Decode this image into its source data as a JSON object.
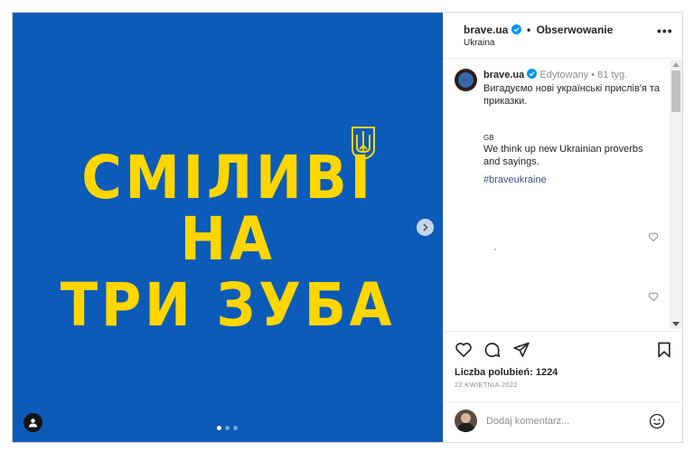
{
  "media": {
    "poster_lines": [
      "СМІЛИВІ",
      "НА",
      "ТРИ ЗУБА"
    ],
    "background_color": "#0d5bb8",
    "text_color": "#ffd600",
    "icons": [
      "trident-icon",
      "chevron-right-icon",
      "person-tag-icon"
    ],
    "carousel": {
      "total": 3,
      "active": 1
    }
  },
  "header": {
    "username": "brave.ua",
    "separator": "•",
    "follow_label": "Obserwowanie",
    "location": "Ukraina",
    "more_label": "•••"
  },
  "caption": {
    "username": "brave.ua",
    "meta": "Edytowany •  81 tyg.",
    "text_ua": "Вигадуємо нові українські прислів'я та приказки.",
    "gb_label": "GB",
    "text_en": "We think up new Ukrainian proverbs and sayings.",
    "hashtag": "#braveukraine"
  },
  "engagement": {
    "likes": "Liczba polubień: 1224",
    "date": "22 KWIETNIA 2022"
  },
  "add_comment": {
    "placeholder": "Dodaj komentarz..."
  },
  "colors": {
    "verified": "#0095f6",
    "hashtag": "#385185",
    "muted": "#8e8e8e"
  }
}
